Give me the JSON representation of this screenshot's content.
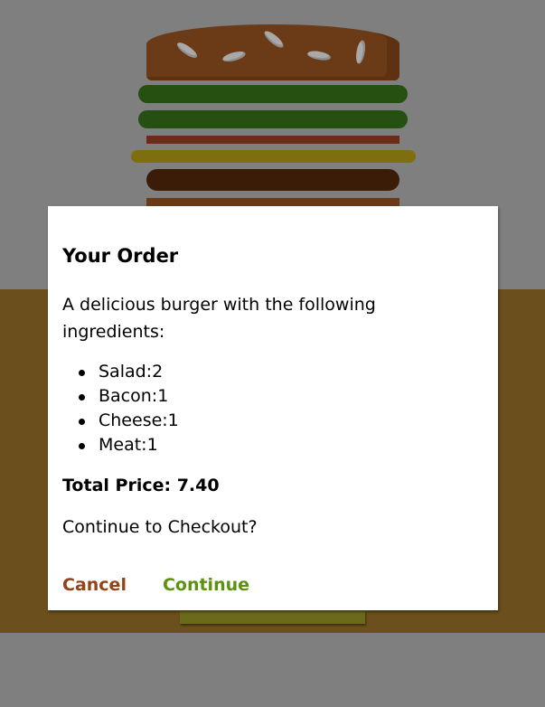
{
  "modal": {
    "title": "Your Order",
    "description": "A delicious burger with the following ingredients:",
    "ingredients": [
      {
        "label": "Salad:2"
      },
      {
        "label": "Bacon:1"
      },
      {
        "label": "Cheese:1"
      },
      {
        "label": "Meat:1"
      }
    ],
    "total_price": "Total Price: 7.40",
    "prompt": "Continue to Checkout?",
    "cancel_label": "Cancel",
    "continue_label": "Continue"
  },
  "colors": {
    "backdrop": "#7f7f7f",
    "burger_area": "#6b4f1c",
    "cancel": "#944317",
    "continue": "#5c9210"
  }
}
